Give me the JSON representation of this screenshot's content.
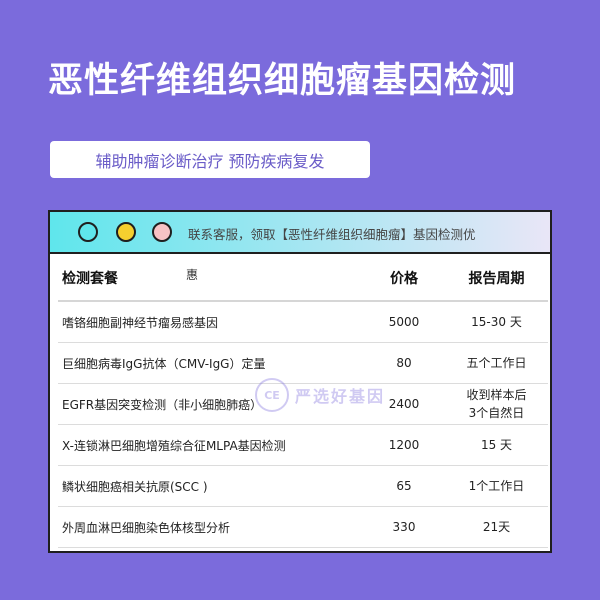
{
  "title": "恶性纤维组织细胞瘤基因检测",
  "subtitle": "辅助肿瘤诊断治疗 预防疾病复发",
  "window": {
    "notice": "联系客服，领取【恶性纤维组织细胞瘤】基因检测优",
    "notice_tail": "惠",
    "colors": {
      "dot1": "#5fe6ec",
      "dot2": "#f5cf2f",
      "dot3": "#f7c3c5"
    }
  },
  "table": {
    "headers": [
      "检测套餐",
      "价格",
      "报告周期"
    ],
    "rows": [
      [
        "嗜铬细胞副神经节瘤易感基因",
        "5000",
        "15-30 天"
      ],
      [
        "巨细胞病毒IgG抗体（CMV-IgG）定量",
        "80",
        "五个工作日"
      ],
      [
        "EGFR基因突变检测（非小细胞肺癌）",
        "2400",
        "收到样本后3个自然日"
      ],
      [
        "X-连锁淋巴细胞增殖综合征MLPA基因检测",
        "1200",
        "15 天"
      ],
      [
        "鳞状细胞癌相关抗原(SCC )",
        "65",
        "1个工作日"
      ],
      [
        "外周血淋巴细胞染色体核型分析",
        "330",
        "21天"
      ]
    ]
  },
  "watermark": {
    "logo": "CE",
    "text": "严选好基因"
  },
  "colors": {
    "background": "#7b6bdc",
    "accent": "#6a5cc8"
  }
}
